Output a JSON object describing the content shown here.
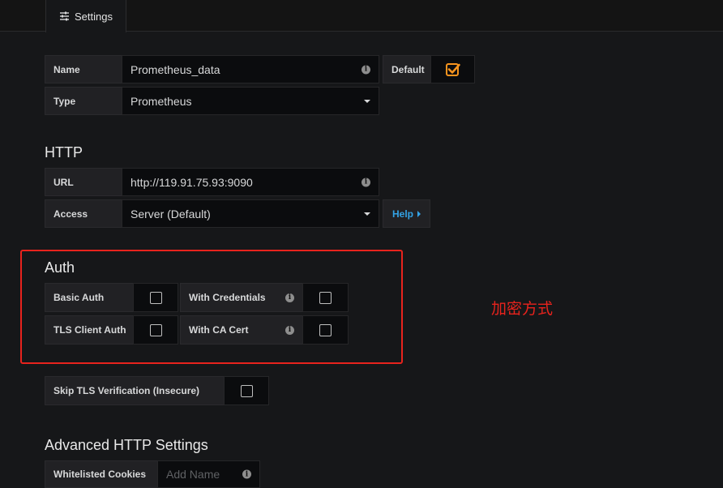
{
  "tabs": {
    "settings_label": "Settings"
  },
  "basic": {
    "name_label": "Name",
    "name_value": "Prometheus_data",
    "default_label": "Default",
    "default_checked": true,
    "type_label": "Type",
    "type_value": "Prometheus"
  },
  "http": {
    "title": "HTTP",
    "url_label": "URL",
    "url_value": "http://119.91.75.93:9090",
    "access_label": "Access",
    "access_value": "Server (Default)",
    "help_label": "Help"
  },
  "auth": {
    "title": "Auth",
    "basic_auth_label": "Basic Auth",
    "with_credentials_label": "With Credentials",
    "tls_client_auth_label": "TLS Client Auth",
    "with_ca_cert_label": "With CA Cert"
  },
  "annotation": {
    "text": "加密方式",
    "color": "#e8231d"
  },
  "skip_tls": {
    "label": "Skip TLS Verification (Insecure)"
  },
  "advanced": {
    "title": "Advanced HTTP Settings",
    "whitelisted_cookies_label": "Whitelisted Cookies",
    "add_name_placeholder": "Add Name"
  },
  "colors": {
    "accent": "#f7941e",
    "link": "#33a2e5",
    "background": "#161719"
  }
}
